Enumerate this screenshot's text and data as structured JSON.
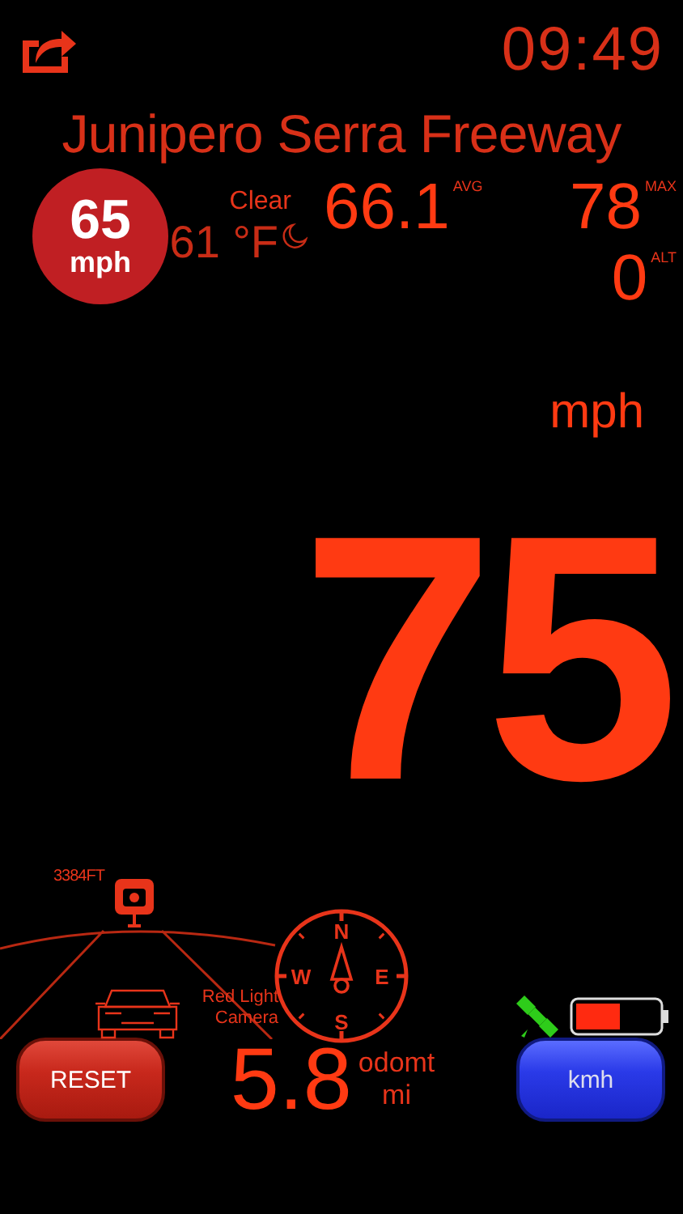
{
  "clock": "09:49",
  "road_name": "Junipero Serra Freeway",
  "speed_limit": {
    "value": "65",
    "unit": "mph"
  },
  "weather": {
    "condition": "Clear",
    "temperature": "61 °F"
  },
  "stats": [
    {
      "value": "66.1",
      "label": "AVG"
    },
    {
      "value": "78",
      "label": "MAX"
    },
    {
      "value": "0",
      "label": "ALT"
    }
  ],
  "speed": {
    "unit": "mph",
    "value": "75"
  },
  "camera_alert": {
    "distance": "3384FT",
    "label": "Red Light Camera"
  },
  "compass": [
    "N",
    "E",
    "S",
    "W"
  ],
  "odometer": {
    "value": "5.8",
    "label": "odomt",
    "unit": "mi"
  },
  "buttons": [
    {
      "label": "RESET",
      "kind": "reset"
    },
    {
      "label": "kmh",
      "kind": "unit"
    }
  ]
}
